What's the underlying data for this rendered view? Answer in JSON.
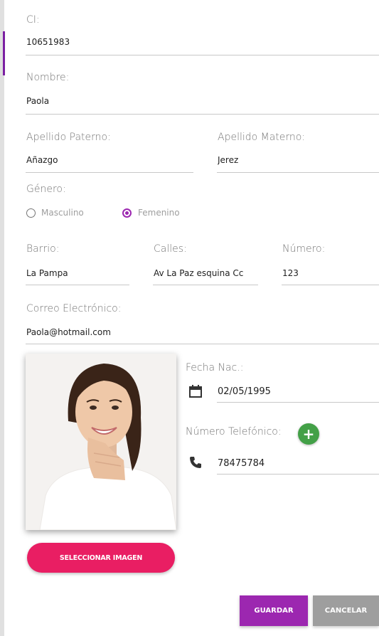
{
  "colors": {
    "primary": "#9c27b0",
    "accent": "#e91e63",
    "add": "#43a047",
    "cancel": "#9e9e9e"
  },
  "ci": {
    "label": "CI:",
    "value": "10651983"
  },
  "nombre": {
    "label": "Nombre:",
    "value": "Paola"
  },
  "apellido_paterno": {
    "label": "Apellido Paterno:",
    "value": "Añazgo"
  },
  "apellido_materno": {
    "label": "Apellido Materno:",
    "value": "Jerez"
  },
  "genero": {
    "label": "Género:",
    "options": [
      {
        "label": "Masculino",
        "selected": false
      },
      {
        "label": "Femenino",
        "selected": true
      }
    ]
  },
  "barrio": {
    "label": "Barrio:",
    "value": "La Pampa"
  },
  "calles": {
    "label": "Calles:",
    "value": "Av La Paz esquina Cc"
  },
  "numero": {
    "label": "Número:",
    "value": "123"
  },
  "correo": {
    "label": "Correo Electrónico:",
    "value": "Paola@hotmail.com"
  },
  "fecha_nac": {
    "label": "Fecha Nac.:",
    "value": "02/05/1995",
    "icon": "calendar-icon"
  },
  "telefono": {
    "label": "Número Telefónico:",
    "value": "78475784",
    "icon": "phone-icon",
    "add_label": "+"
  },
  "photo": {
    "icon": "profile-photo"
  },
  "buttons": {
    "select_image": "SELECCIONAR IMAGEN",
    "save": "GUARDAR",
    "cancel": "CANCELAR"
  }
}
